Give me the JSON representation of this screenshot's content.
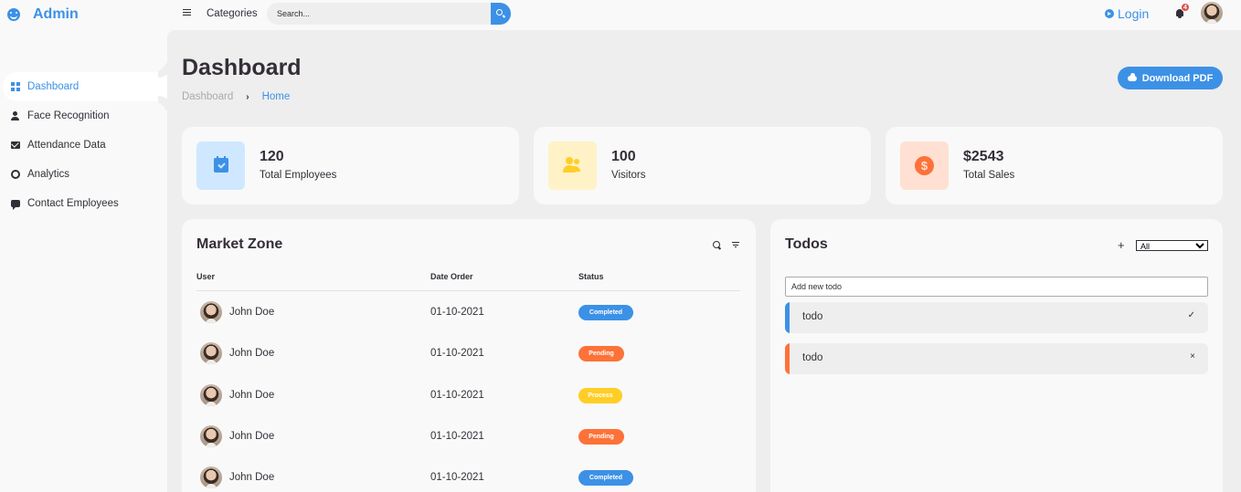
{
  "brand": {
    "name": "Admin"
  },
  "sidebar": {
    "items": [
      {
        "label": "Dashboard"
      },
      {
        "label": "Face Recognition"
      },
      {
        "label": "Attendance Data"
      },
      {
        "label": "Analytics"
      },
      {
        "label": "Contact Employees"
      }
    ]
  },
  "topnav": {
    "categories_label": "Categories",
    "search_placeholder": "Search...",
    "login_label": "Login",
    "notification_count": "4"
  },
  "header": {
    "title": "Dashboard",
    "breadcrumb": [
      "Dashboard",
      "Home"
    ],
    "download_label": "Download PDF"
  },
  "stats": [
    {
      "value": "120",
      "label": "Total Employees",
      "color": "#3c91e6",
      "bg": "#cfe8ff"
    },
    {
      "value": "100",
      "label": "Visitors",
      "color": "#ffce26",
      "bg": "#fff2c6"
    },
    {
      "value": "$2543",
      "label": "Total Sales",
      "color": "#fd7238",
      "bg": "#ffe0d3",
      "glyph": "$"
    }
  ],
  "market": {
    "title": "Market Zone",
    "columns": [
      "User",
      "Date Order",
      "Status"
    ],
    "rows": [
      {
        "user": "John Doe",
        "date": "01-10-2021",
        "status": "Completed"
      },
      {
        "user": "John Doe",
        "date": "01-10-2021",
        "status": "Pending"
      },
      {
        "user": "John Doe",
        "date": "01-10-2021",
        "status": "Process"
      },
      {
        "user": "John Doe",
        "date": "01-10-2021",
        "status": "Pending"
      },
      {
        "user": "John Doe",
        "date": "01-10-2021",
        "status": "Completed"
      }
    ]
  },
  "status_colors": {
    "Completed": "#3c91e6",
    "Pending": "#fd7238",
    "Process": "#ffce26"
  },
  "todos": {
    "title": "Todos",
    "add_glyph": "+",
    "filter_selected": "All",
    "input_placeholder": "Add new todo",
    "items": [
      {
        "text": "todo",
        "action": "✓",
        "color": "#3c91e6"
      },
      {
        "text": "todo",
        "action": "×",
        "color": "#fd7238"
      }
    ]
  }
}
